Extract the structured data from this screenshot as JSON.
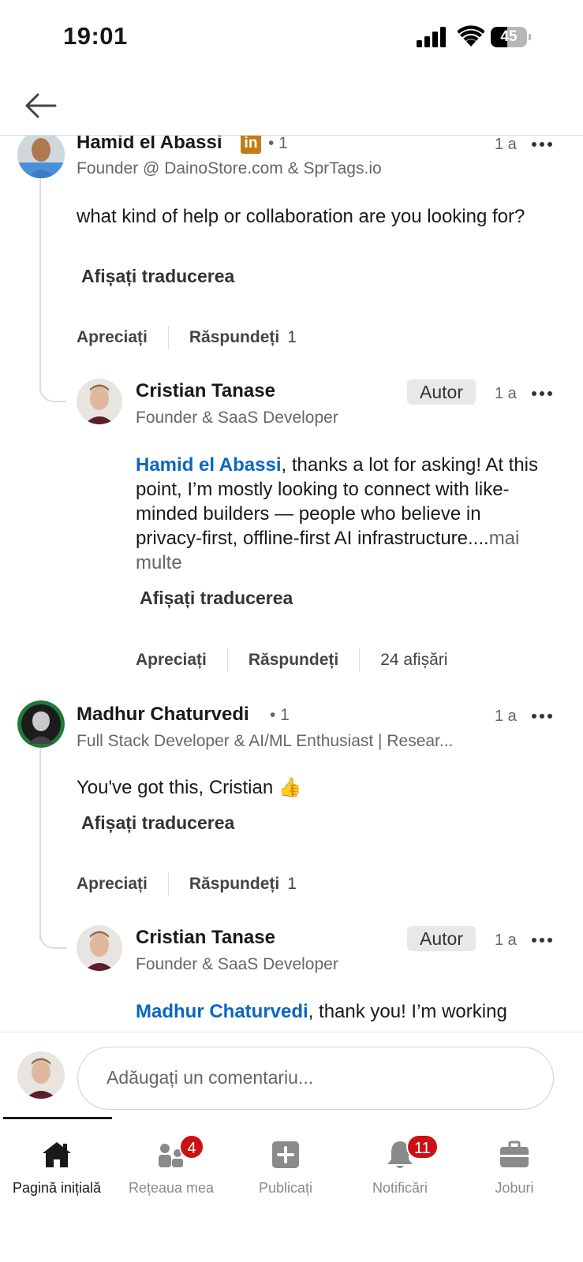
{
  "status_bar": {
    "time": "19:01",
    "battery": "45",
    "battery_level": 0.45
  },
  "nav": {
    "back": "back"
  },
  "comments": [
    {
      "name": "Hamid el Abassi",
      "premium_badge": "in",
      "degree": "• 1",
      "headline": "Founder @ DainoStore.com & SprTags.io",
      "time": "1 a",
      "text": "what kind of help or collaboration are you looking for?",
      "translate": "Afișați traducerea",
      "like": "Apreciați",
      "reply": "Răspundeți",
      "reply_count": "1",
      "reply_item": {
        "name": "Cristian Tanase",
        "badge": "Autor",
        "time": "1 a",
        "headline": "Founder & SaaS Developer",
        "mention": "Hamid el Abassi",
        "text": ", thanks a lot for asking! At this point, I’m mostly looking to connect with like-minded builders — people who believe in privacy-first, offline-first AI infrastructure....",
        "see_more": "mai multe",
        "translate": "Afișați traducerea",
        "like": "Apreciați",
        "reply": "Răspundeți",
        "views": "24 afișări"
      }
    },
    {
      "name": "Madhur Chaturvedi",
      "degree": "• 1",
      "headline": "Full Stack Developer & AI/ML Enthusiast | Resear...",
      "time": "1 a",
      "text": "You've got this, Cristian 👍",
      "translate": "Afișați traducerea",
      "like": "Apreciați",
      "reply": "Răspundeți",
      "reply_count": "1",
      "reply_item": {
        "name": "Cristian Tanase",
        "badge": "Autor",
        "time": "1 a",
        "headline": "Founder & SaaS Developer",
        "mention": "Madhur Chaturvedi",
        "text": ", thank you! I’m working"
      }
    }
  ],
  "composer": {
    "placeholder": "Adăugați un comentariu..."
  },
  "bottom_nav": [
    {
      "label": "Pagină inițială",
      "icon": "home-icon",
      "active": true
    },
    {
      "label": "Rețeaua mea",
      "icon": "network-icon",
      "badge": "4"
    },
    {
      "label": "Publicați",
      "icon": "post-icon"
    },
    {
      "label": "Notificări",
      "icon": "bell-icon",
      "badge": "11"
    },
    {
      "label": "Joburi",
      "icon": "briefcase-icon"
    }
  ],
  "colors": {
    "link": "#0a66c2",
    "badge_red": "#cc1016",
    "premium": "#c37d16"
  }
}
